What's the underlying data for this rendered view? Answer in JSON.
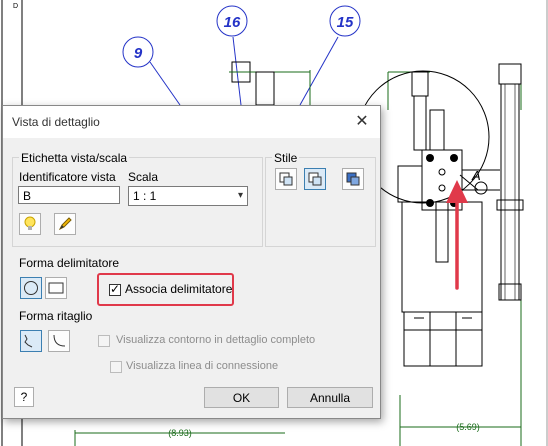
{
  "drawing": {
    "balloons": [
      "9",
      "16",
      "15"
    ],
    "dimensions": [
      "(8.93)",
      "(5.69)"
    ],
    "detail_label": "A",
    "corner_label": "D"
  },
  "dialog": {
    "title": "Vista di dettaglio",
    "close_glyph": "✕",
    "group_etichetta": {
      "title": "Etichetta vista/scala",
      "identificatore_label": "Identificatore vista",
      "identificatore_value": "B",
      "scala_label": "Scala",
      "scala_value": "1 : 1"
    },
    "group_stile": {
      "title": "Stile"
    },
    "forma_delimitatore": {
      "label": "Forma delimitatore",
      "associa_label": "Associa delimitatore",
      "associa_checked": true
    },
    "forma_ritaglio": {
      "label": "Forma ritaglio",
      "contorno_label": "Visualizza contorno in dettaglio completo",
      "linea_label": "Visualizza linea di connessione"
    },
    "buttons": {
      "ok": "OK",
      "cancel": "Annulla",
      "help": "?"
    }
  },
  "colors": {
    "balloon": "#2433c7",
    "dimension": "#1a6b1a",
    "highlight": "#e0394a",
    "arrow": "#e0394a"
  }
}
